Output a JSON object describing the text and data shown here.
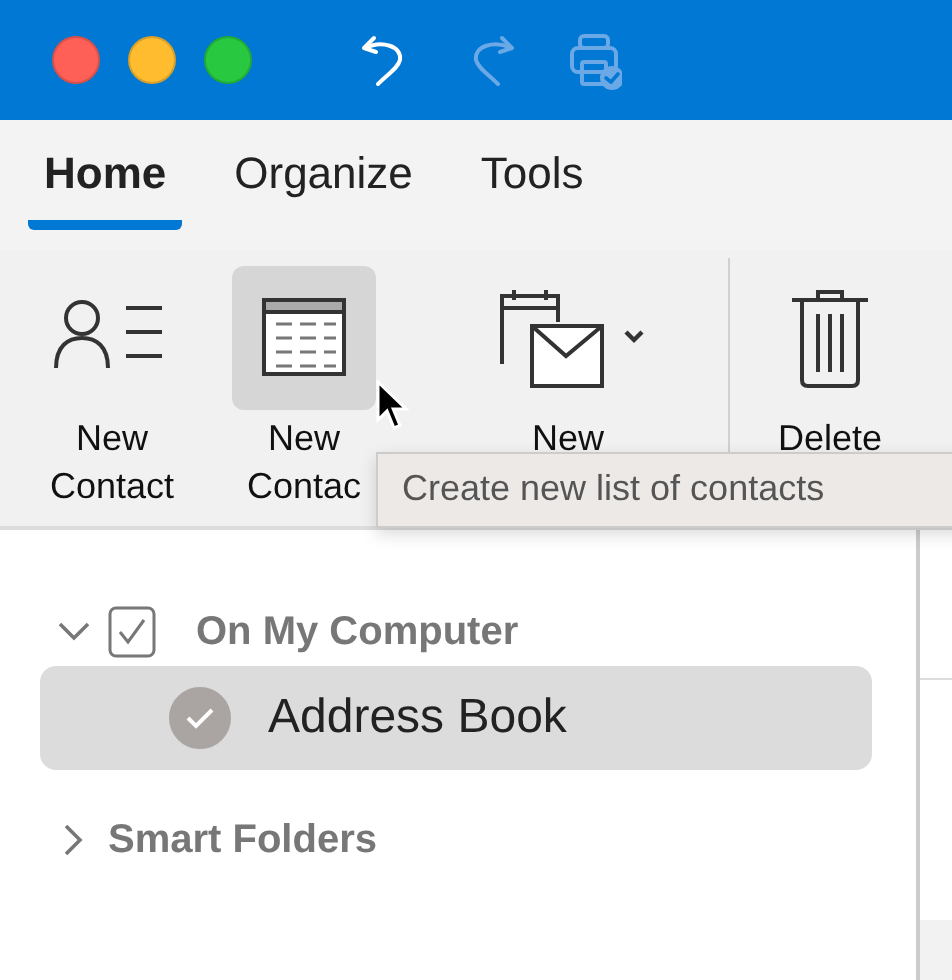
{
  "toolbar": [
    {
      "kind": "undo",
      "disabled": false
    },
    {
      "kind": "redo",
      "disabled": true
    },
    {
      "kind": "print",
      "disabled": true
    }
  ],
  "tabs": [
    {
      "label": "Home",
      "selected": true
    },
    {
      "label": "Organize",
      "selected": false
    },
    {
      "label": "Tools",
      "selected": false
    }
  ],
  "ribbon": [
    {
      "kind": "contact",
      "label": "New\nContact",
      "pressed": false
    },
    {
      "kind": "list",
      "label": "New\nContac",
      "pressed": true
    },
    {
      "kind": "item",
      "label": "New",
      "pressed": false
    },
    {
      "kind": "delete",
      "label": "Delete",
      "pressed": false
    }
  ],
  "tooltip": {
    "text": "Create new list of contacts"
  },
  "sidebar": {
    "items": [
      {
        "label": "On My Computer",
        "expanded": true,
        "checked": true,
        "children": [
          {
            "label": "Address Book",
            "selected": true,
            "checked": true
          }
        ]
      },
      {
        "label": "Smart Folders",
        "expanded": false
      }
    ]
  }
}
